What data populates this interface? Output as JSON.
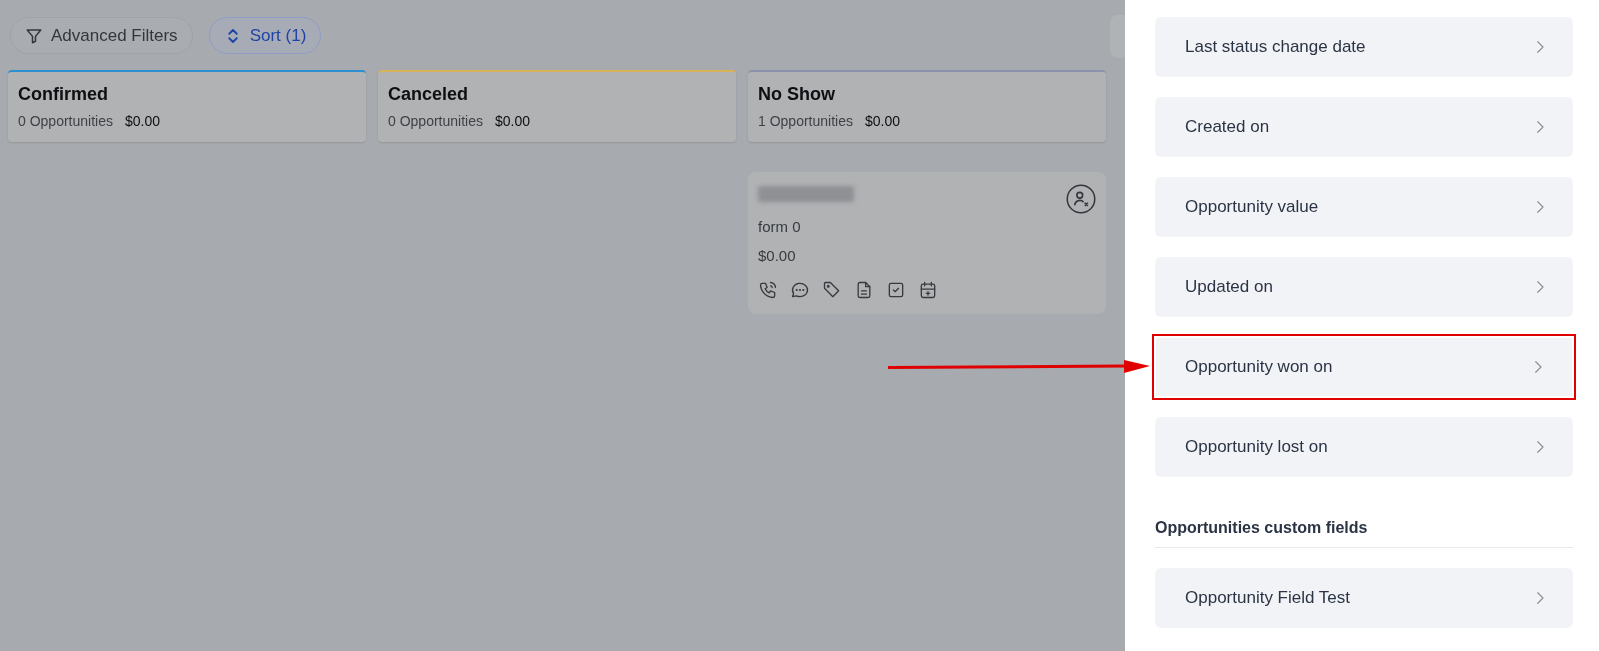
{
  "toolbar": {
    "buttons": [
      {
        "kind": "filter",
        "label": "Advanced Filters",
        "selected": false
      },
      {
        "kind": "sort",
        "label": "Sort (1)",
        "selected": true
      }
    ]
  },
  "columns": [
    {
      "name": "Confirmed",
      "count": "0 Opportunities",
      "total": "$0.00",
      "color": "#2d8fd0"
    },
    {
      "name": "Canceled",
      "count": "0 Opportunities",
      "total": "$0.00",
      "color": "#d9b35a"
    },
    {
      "name": "No Show",
      "count": "1 Opportunities",
      "total": "$0.00",
      "color": "#8e93ad",
      "cards": [
        {
          "source": "form 0",
          "value": "$0.00"
        }
      ]
    }
  ],
  "panel": {
    "items": [
      {
        "label": "Last status change date",
        "highlighted": false
      },
      {
        "label": "Created on",
        "highlighted": false
      },
      {
        "label": "Opportunity value",
        "highlighted": false
      },
      {
        "label": "Updated on",
        "highlighted": false
      },
      {
        "label": "Opportunity won on",
        "highlighted": true
      },
      {
        "label": "Opportunity lost on",
        "highlighted": false
      }
    ],
    "custom_section": {
      "title": "Opportunities custom fields",
      "items": [
        {
          "label": "Opportunity Field Test",
          "highlighted": false
        }
      ]
    }
  }
}
